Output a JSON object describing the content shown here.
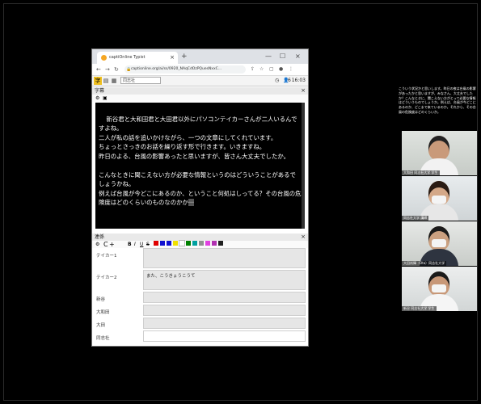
{
  "browser": {
    "tab_title": "captiOnline Typist",
    "tab_close": "×",
    "new_tab": "+",
    "url": "captionline.org/ai/ss/0920_NAqCdOzPQuesNxxC...",
    "window_controls": [
      "—",
      "☐",
      "×"
    ]
  },
  "app_toolbar": {
    "input_value": "同志社",
    "time": "16:03",
    "user_count": "6"
  },
  "caption_panel": {
    "label": "字幕",
    "close": "×",
    "text": "新谷君と大和田君と大田君以外にパソコンテイカーさんが二人いるんですよね。\n二人が私の話を追いかけながら、一つの文章にしてくれています。\nちょっとさっきのお話を繰り返す形で行きます。いきますね。\n昨日のよる、台風の影響あったと思いますが、皆さん大丈夫でしたか。\n\nこんなときに聞こえない方が必要な情報というのはどういうことがあるでしょうかね。\n例えば台風が今どこにあるのか、ということ何処はしってる？その台風の危険度はどのくらいのものなのかか",
    "cursor_text": "一"
  },
  "relay_panel": {
    "label": "連係",
    "close": "×",
    "format_buttons": [
      "B",
      "I",
      "U",
      "S"
    ],
    "palette": [
      "#e00000",
      "#1010d0",
      "#1010d0",
      "#f0e000",
      "#ffffff",
      "#008000",
      "#00a0a0",
      "#909090",
      "#e040e0",
      "#b030b0",
      "#202020"
    ]
  },
  "typists": [
    {
      "label": "テイカー1",
      "text": ""
    },
    {
      "label": "テイカー2",
      "text": "また、こうきょうこうて"
    },
    {
      "label": "新谷",
      "text": ""
    },
    {
      "label": "大和田",
      "text": ""
    },
    {
      "label": "大田",
      "text": ""
    },
    {
      "label": "同志社",
      "text": ""
    }
  ],
  "side_caption": "こういう状況かと思いします。昨日の夜は台風の影響があったかと思いますが、みなさん、大丈夫でしたか？こんなときに、聞こえない方がとって必要な情報はどういうものでしょうか。例えば、台風が今どこにあるのか、どこまで来ているのか。それから、その台風の危険度はどのくらいか。",
  "participants": [
    {
      "name": "大和田 同志社大学 学生"
    },
    {
      "name": "同志社大学 講師"
    },
    {
      "name": "大田尚輝（Ota）同志社大学"
    },
    {
      "name": "新谷 同志社大学 学生"
    }
  ]
}
